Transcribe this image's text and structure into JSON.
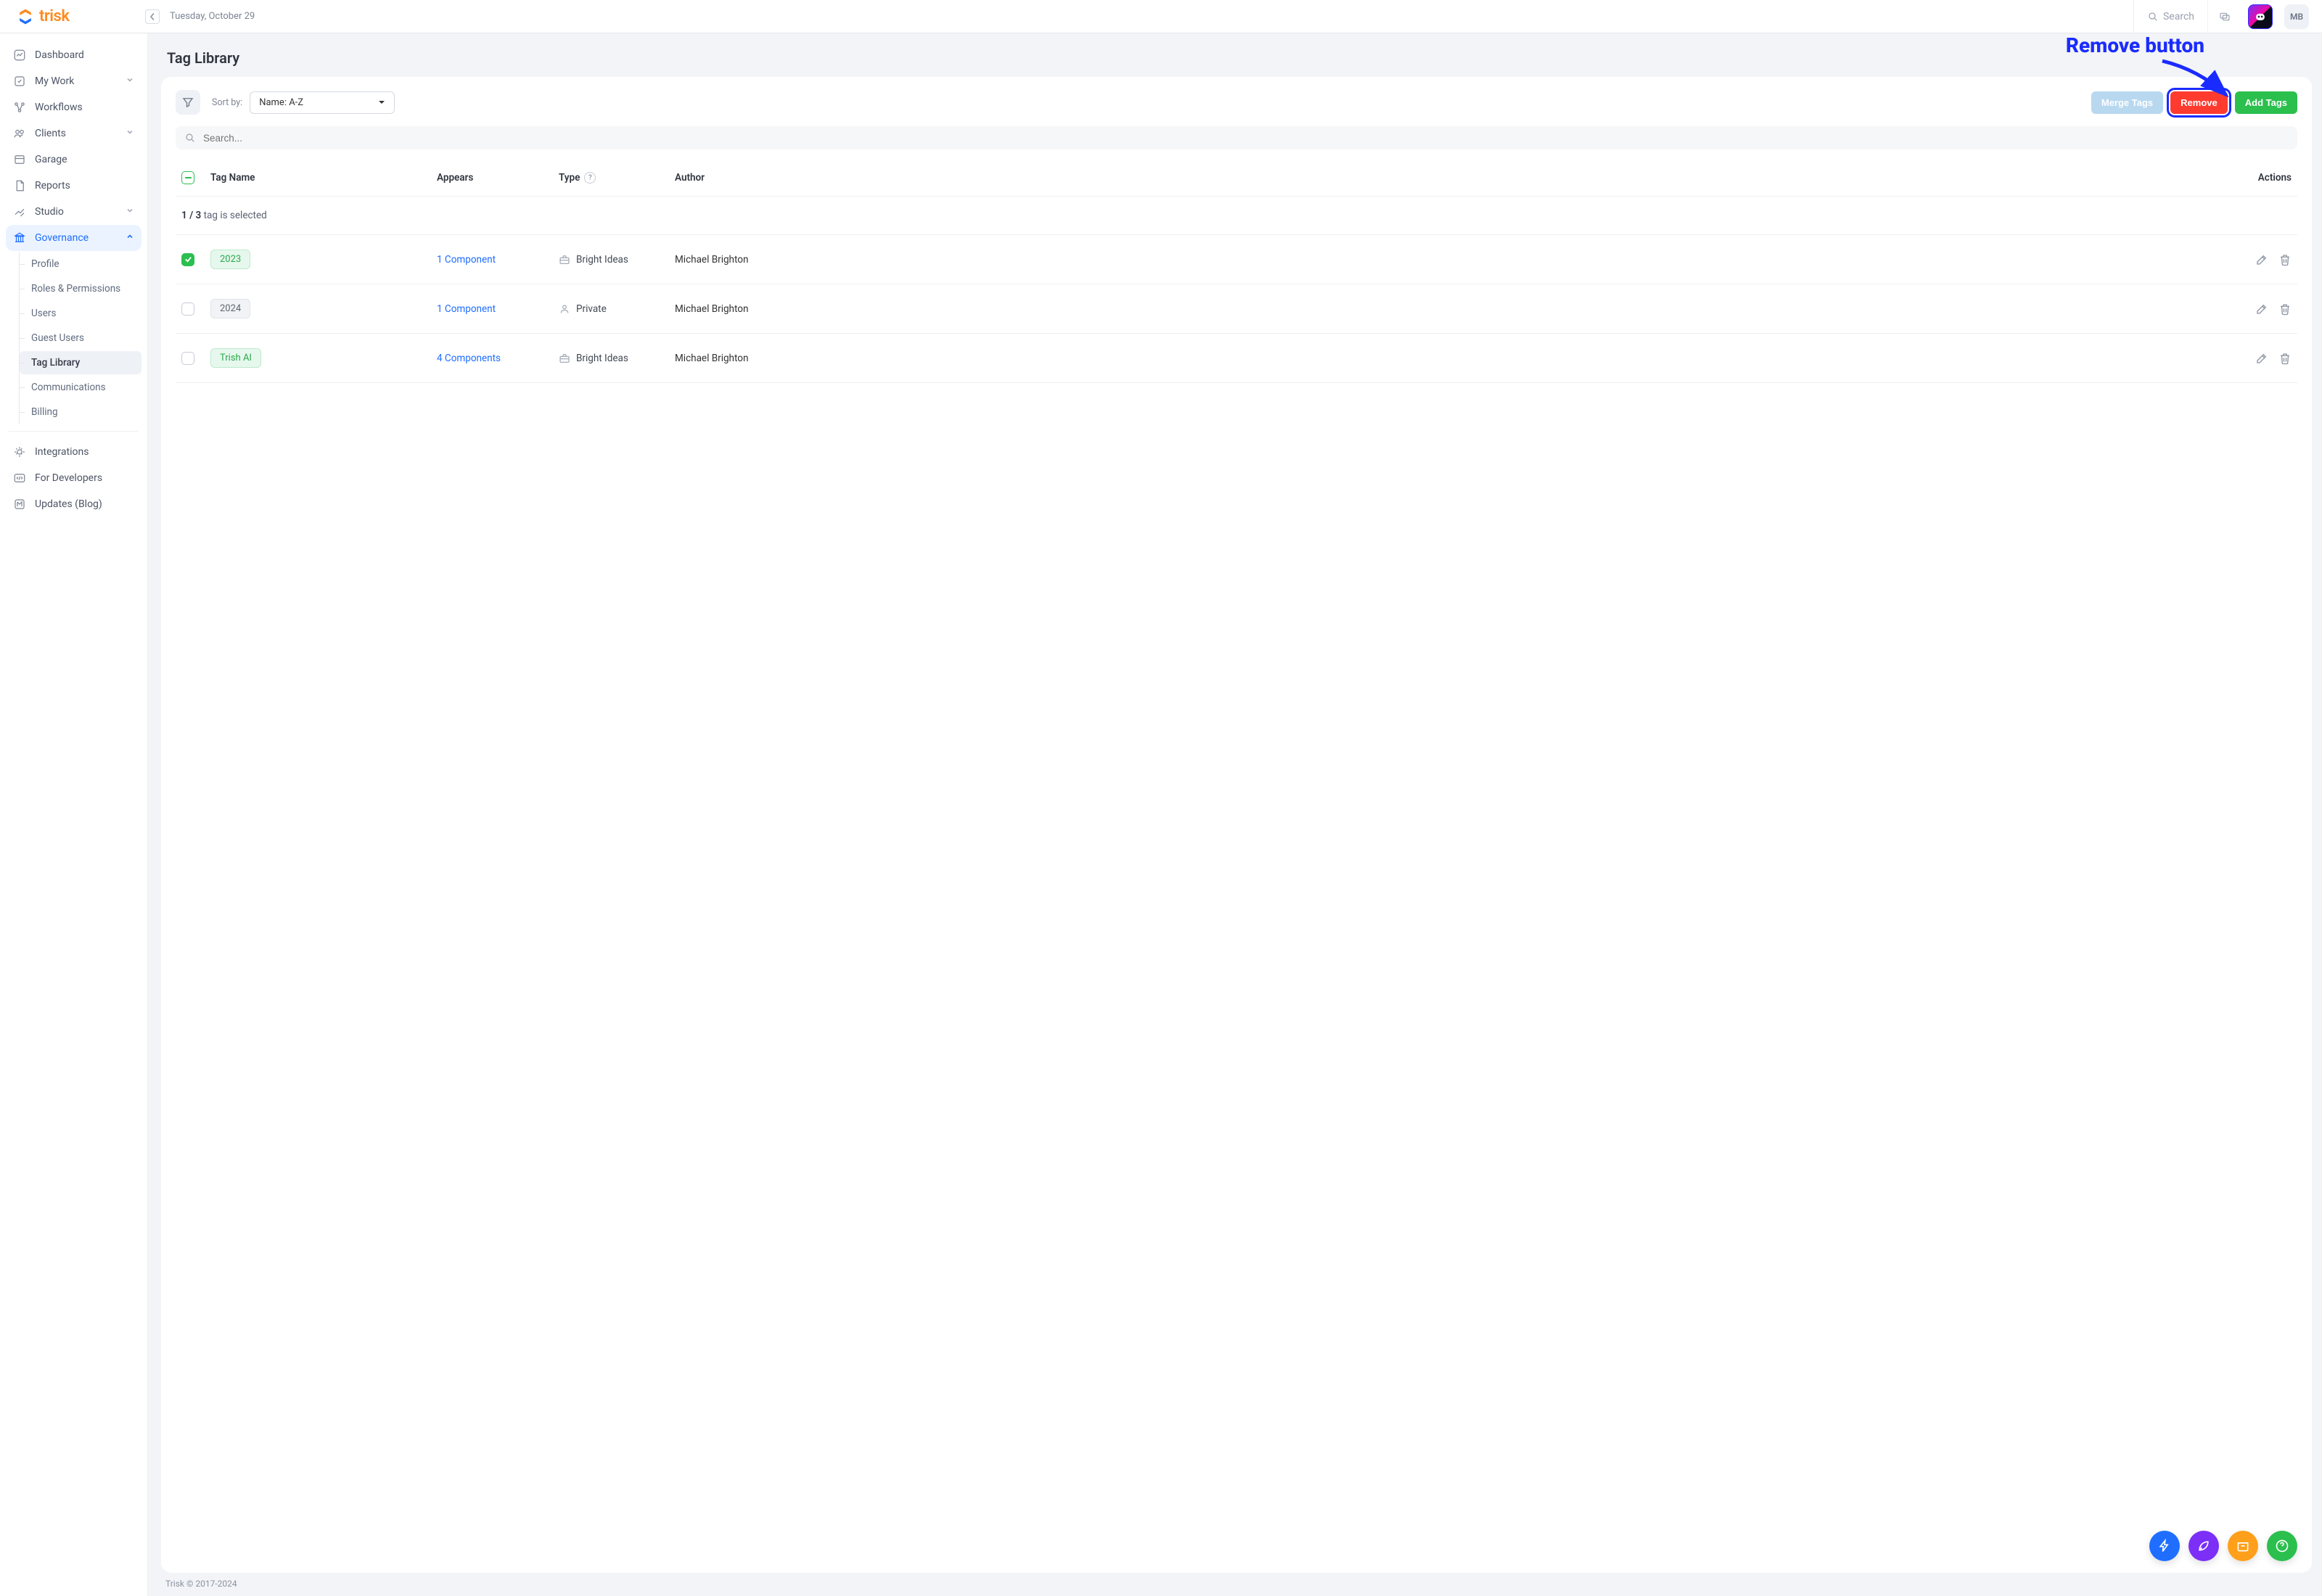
{
  "brand": {
    "name": "trisk"
  },
  "topbar": {
    "date": "Tuesday, October 29",
    "search_placeholder": "Search",
    "avatar_initials": "MB"
  },
  "sidebar": {
    "items": [
      {
        "label": "Dashboard"
      },
      {
        "label": "My Work",
        "expandable": true
      },
      {
        "label": "Workflows"
      },
      {
        "label": "Clients",
        "expandable": true
      },
      {
        "label": "Garage"
      },
      {
        "label": "Reports"
      },
      {
        "label": "Studio",
        "expandable": true
      },
      {
        "label": "Governance",
        "expandable": true,
        "active": true
      }
    ],
    "governance_sub": [
      {
        "label": "Profile"
      },
      {
        "label": "Roles & Permissions"
      },
      {
        "label": "Users"
      },
      {
        "label": "Guest Users"
      },
      {
        "label": "Tag Library",
        "active": true
      },
      {
        "label": "Communications"
      },
      {
        "label": "Billing"
      }
    ],
    "lower": [
      {
        "label": "Integrations"
      },
      {
        "label": "For Developers"
      },
      {
        "label": "Updates (Blog)"
      }
    ]
  },
  "page": {
    "title": "Tag Library",
    "sort_by_label": "Sort by:",
    "sort_value": "Name: A-Z",
    "search_placeholder": "Search...",
    "buttons": {
      "merge": "Merge Tags",
      "remove": "Remove",
      "add": "Add Tags"
    },
    "columns": {
      "tag": "Tag Name",
      "appears": "Appears",
      "type": "Type",
      "author": "Author",
      "actions": "Actions"
    },
    "selection_text_prefix": "1 / 3",
    "selection_text_suffix": " tag is selected",
    "rows": [
      {
        "checked": true,
        "tag": "2023",
        "tag_style": "green",
        "appears": "1 Component",
        "type": "Bright Ideas",
        "type_icon": "briefcase",
        "author": "Michael Brighton"
      },
      {
        "checked": false,
        "tag": "2024",
        "tag_style": "gray",
        "appears": "1 Component",
        "type": "Private",
        "type_icon": "person",
        "author": "Michael Brighton"
      },
      {
        "checked": false,
        "tag": "Trish AI",
        "tag_style": "green",
        "appears": "4 Components",
        "type": "Bright Ideas",
        "type_icon": "briefcase",
        "author": "Michael Brighton"
      }
    ]
  },
  "annotation": {
    "label": "Remove button"
  },
  "footer": {
    "copyright": "Trisk © 2017-2024"
  }
}
